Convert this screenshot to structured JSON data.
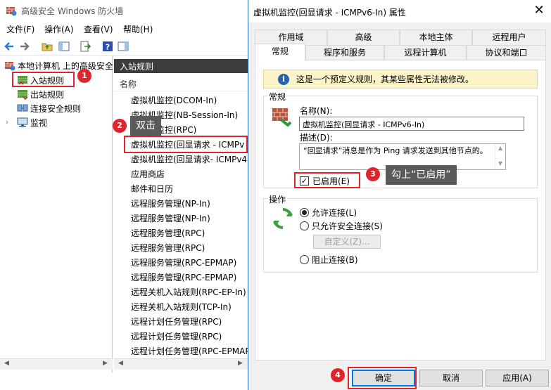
{
  "main_window": {
    "title": "高级安全 Windows 防火墙",
    "menu": [
      "文件(F)",
      "操作(A)",
      "查看(V)",
      "帮助(H)"
    ],
    "tree": {
      "root": "本地计算机 上的高级安全",
      "items": [
        "入站规则",
        "出站规则",
        "连接安全规则",
        "监视"
      ]
    },
    "list": {
      "header": "入站规则",
      "column": "名称",
      "rows": [
        {
          "label": "虚拟机监控(DCOM-In)",
          "enabled": false
        },
        {
          "label": "虚拟机监控(NB-Session-In)",
          "enabled": false
        },
        {
          "label": "虚拟机监控(RPC)",
          "enabled": false
        },
        {
          "label": "虚拟机监控(回显请求 - ICMPv",
          "enabled": false
        },
        {
          "label": "虚拟机监控(回显请求- ICMPv4",
          "enabled": false
        },
        {
          "label": "应用商店",
          "enabled": true
        },
        {
          "label": "邮件和日历",
          "enabled": true
        },
        {
          "label": "远程服务管理(NP-In)",
          "enabled": false
        },
        {
          "label": "远程服务管理(NP-In)",
          "enabled": false
        },
        {
          "label": "远程服务管理(RPC)",
          "enabled": false
        },
        {
          "label": "远程服务管理(RPC)",
          "enabled": false
        },
        {
          "label": "远程服务管理(RPC-EPMAP)",
          "enabled": false
        },
        {
          "label": "远程服务管理(RPC-EPMAP)",
          "enabled": false
        },
        {
          "label": "远程关机入站规则(RPC-EP-In)",
          "enabled": false
        },
        {
          "label": "远程关机入站规则(TCP-In)",
          "enabled": false
        },
        {
          "label": "远程计划任务管理(RPC)",
          "enabled": false
        },
        {
          "label": "远程计划任务管理(RPC)",
          "enabled": false
        },
        {
          "label": "远程计划任务管理(RPC-EPMAP",
          "enabled": false
        }
      ]
    }
  },
  "dialog": {
    "title": "虚拟机监控(回显请求 - ICMPv6-In) 属性",
    "close": "✕",
    "tabs_row1": [
      "作用域",
      "高级",
      "本地主体",
      "远程用户"
    ],
    "tabs_row2": [
      "常规",
      "程序和服务",
      "远程计算机",
      "协议和端口"
    ],
    "info_icon_glyph": "i",
    "info_text": "这是一个预定义规则，其某些属性无法被修改。",
    "general": {
      "legend": "常规",
      "name_label": "名称(N):",
      "name_value": "虚拟机监控(回显请求 - ICMPv6-In)",
      "desc_label": "描述(D):",
      "desc_value": "“回显请求”消息是作为 Ping 请求发送到其他节点的。",
      "enabled_label": "已启用(E)",
      "enabled_checked": true,
      "check_glyph": "✓"
    },
    "action": {
      "legend": "操作",
      "options": [
        "允许连接(L)",
        "只允许安全连接(S)",
        "阻止连接(B)"
      ],
      "selected_index": 0,
      "customize_label": "自定义(Z)..."
    },
    "buttons": {
      "ok": "确定",
      "cancel": "取消",
      "apply": "应用(A)"
    }
  },
  "annotations": {
    "steps": [
      "1",
      "2",
      "3",
      "4"
    ],
    "callouts": {
      "step2": "双击",
      "step3": "勾上“已启用”"
    }
  },
  "colors": {
    "annotation_red": "#e0242b",
    "callout_bg": "#5a5a5a",
    "info_bg": "#fcf3c8",
    "accent_blue": "#0078d7",
    "enabled_green": "#2aa02a"
  },
  "icons": {
    "app": "firewall-brick-icon",
    "rules": "rule-shield-icon",
    "monitor": "monitor-icon",
    "action": "green-arrows-icon"
  }
}
